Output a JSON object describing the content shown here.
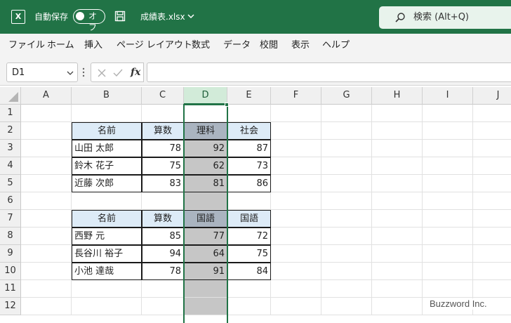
{
  "titlebar": {
    "autosave_label": "自動保存",
    "autosave_state": "オフ",
    "filename": "成績表.xlsx",
    "search_label": "検索 (Alt+Q)",
    "bg_color": "#217346"
  },
  "menu": {
    "items": [
      "ファイル",
      "ホーム",
      "挿入",
      "ページ レイアウト",
      "数式",
      "データ",
      "校閲",
      "表示",
      "ヘルプ"
    ]
  },
  "formula_bar": {
    "name_box": "D1",
    "fx_label": "fx",
    "formula": ""
  },
  "sheet": {
    "columns": [
      "A",
      "B",
      "C",
      "D",
      "E",
      "F",
      "G",
      "H",
      "I",
      "J"
    ],
    "rows": [
      "1",
      "2",
      "3",
      "4",
      "5",
      "6",
      "7",
      "8",
      "9",
      "10",
      "11",
      "12"
    ],
    "selected_column": "D",
    "table1": {
      "headers": [
        "名前",
        "算数",
        "理科",
        "社会"
      ],
      "rows": [
        [
          "山田 太郎",
          "78",
          "92",
          "87"
        ],
        [
          "鈴木 花子",
          "75",
          "62",
          "73"
        ],
        [
          "近藤 次郎",
          "83",
          "81",
          "86"
        ]
      ]
    },
    "table2": {
      "headers": [
        "名前",
        "算数",
        "国語",
        "国語"
      ],
      "rows": [
        [
          "西野 元",
          "85",
          "77",
          "72"
        ],
        [
          "長谷川 裕子",
          "94",
          "64",
          "75"
        ],
        [
          "小池 達哉",
          "78",
          "91",
          "84"
        ]
      ]
    }
  },
  "watermark": "Buzzword Inc."
}
